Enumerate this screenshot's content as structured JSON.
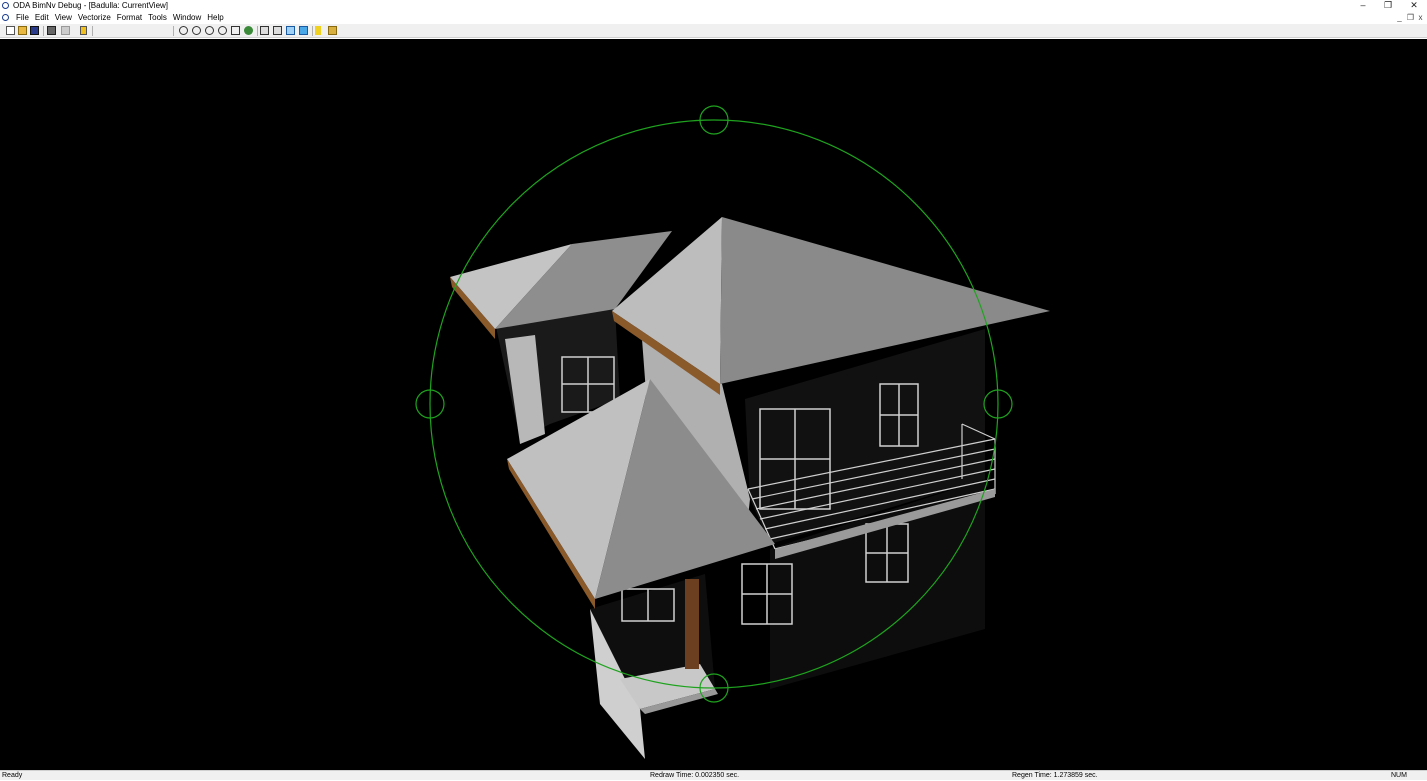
{
  "window": {
    "title": "ODA BimNv Debug - [Badulla: CurrentView]",
    "controls": {
      "minimize": "–",
      "restore": "❐",
      "close": "✕"
    }
  },
  "menu": {
    "items": [
      "File",
      "Edit",
      "View",
      "Vectorize",
      "Format",
      "Tools",
      "Window",
      "Help"
    ],
    "mdi_controls": {
      "minimize": "_",
      "restore": "❐",
      "close": "x"
    }
  },
  "toolbar": {
    "buttons": [
      "new-icon",
      "open-icon",
      "save-icon",
      "print-icon",
      "print-preview-icon",
      "help-icon",
      "zoom-extents-icon",
      "zoom-in-icon",
      "zoom-out-icon",
      "zoom-window-icon",
      "orbit-icon",
      "pan-icon",
      "box-view-icon",
      "box-view-2-icon",
      "wireframe-box-icon",
      "shaded-box-icon",
      "lightning-icon",
      "settings-icon"
    ]
  },
  "viewport": {
    "background": "#000000",
    "orbit_color": "#1fa31f",
    "roof_light": "#b5b5b5",
    "roof_dark": "#8a8a8a",
    "fascia": "#8b5a2b"
  },
  "status": {
    "ready": "Ready",
    "redraw": "Redraw Time: 0.002350 sec.",
    "regen": "Regen Time: 1.273859 sec.",
    "num": "NUM"
  }
}
